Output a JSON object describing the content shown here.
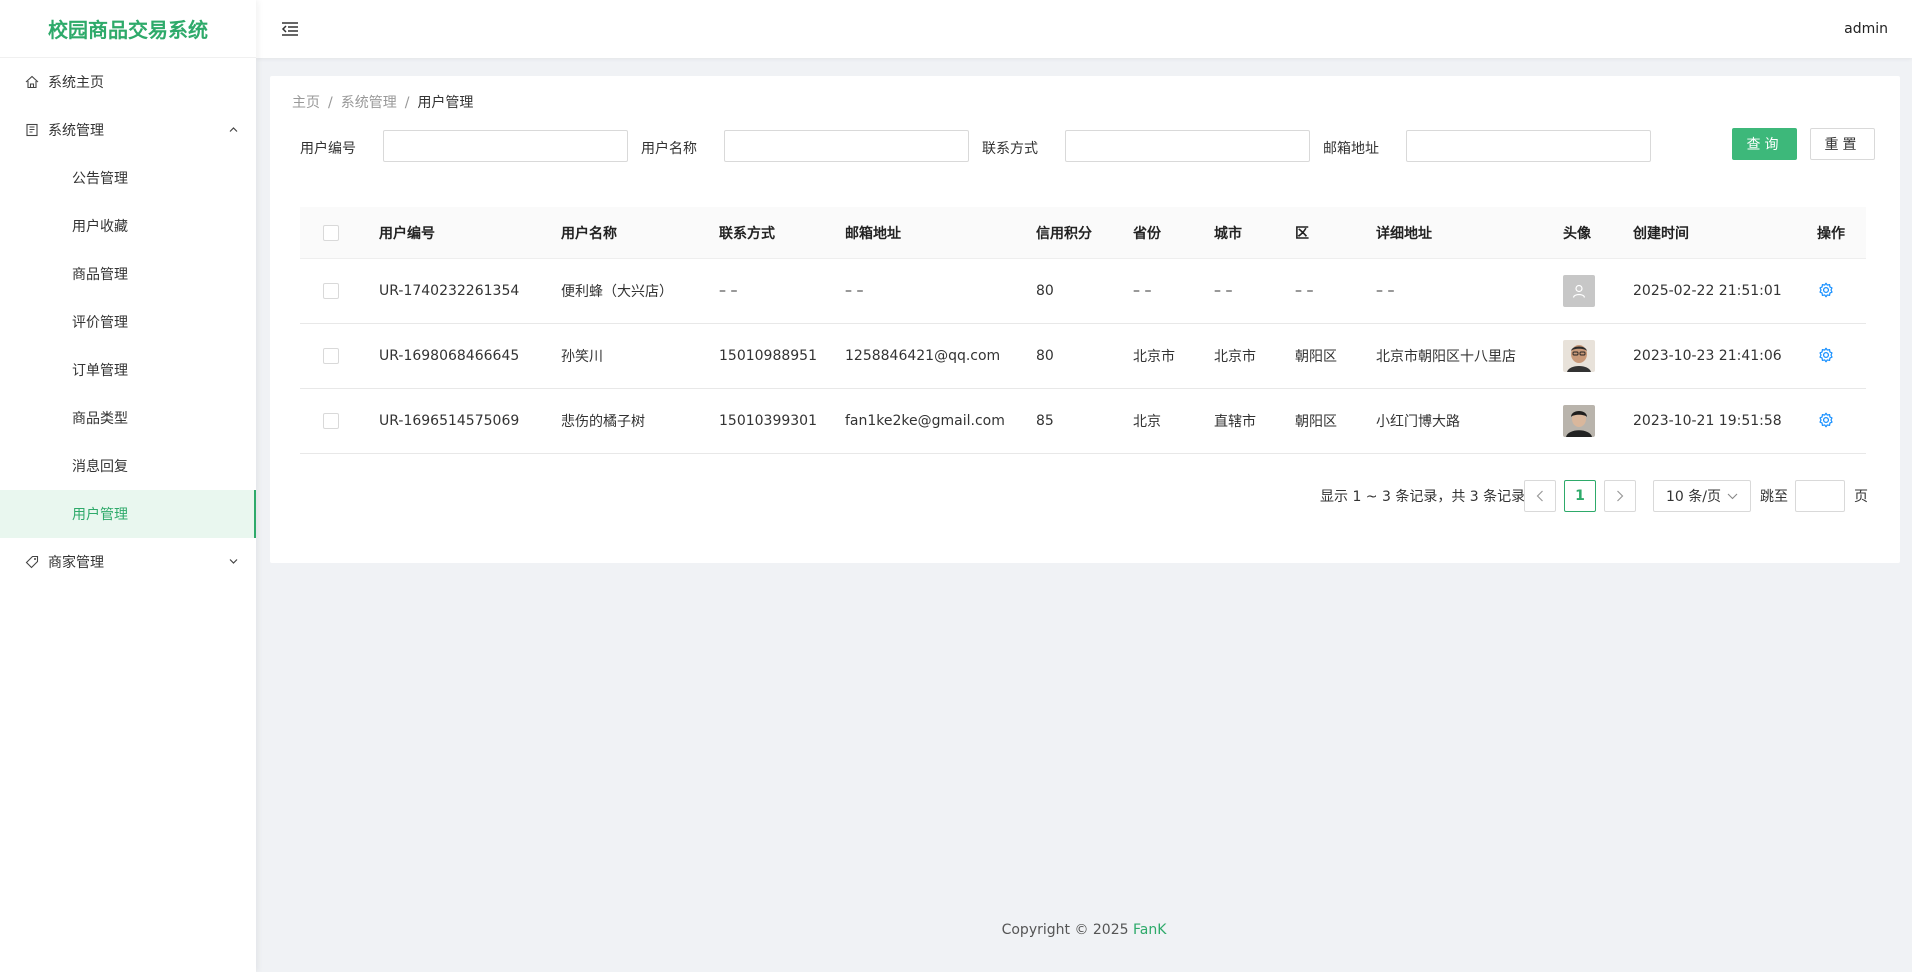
{
  "app": {
    "title": "校园商品交易系统"
  },
  "sidebar": {
    "items": [
      {
        "label": "系统主页",
        "icon": "home-icon"
      },
      {
        "label": "系统管理",
        "icon": "book-icon",
        "expanded": true,
        "children": [
          "公告管理",
          "用户收藏",
          "商品管理",
          "评价管理",
          "订单管理",
          "商品类型",
          "消息回复",
          "用户管理"
        ],
        "active_child": "用户管理"
      },
      {
        "label": "商家管理",
        "icon": "tag-icon",
        "expanded": false
      }
    ]
  },
  "header": {
    "user": "admin"
  },
  "breadcrumb": [
    "主页",
    "系统管理",
    "用户管理"
  ],
  "search": {
    "fields": [
      {
        "label": "用户编号",
        "value": ""
      },
      {
        "label": "用户名称",
        "value": ""
      },
      {
        "label": "联系方式",
        "value": ""
      },
      {
        "label": "邮箱地址",
        "value": ""
      }
    ],
    "query_label": "查询",
    "reset_label": "重置"
  },
  "table": {
    "columns": [
      "用户编号",
      "用户名称",
      "联系方式",
      "邮箱地址",
      "信用积分",
      "省份",
      "城市",
      "区",
      "详细地址",
      "头像",
      "创建时间",
      "操作"
    ],
    "rows": [
      {
        "id": "UR-1740232261354",
        "name": "便利蜂（大兴店）",
        "phone": "– –",
        "email": "– –",
        "credit": "80",
        "province": "– –",
        "city": "– –",
        "district": "– –",
        "address": "– –",
        "avatar": "default-avatar-icon",
        "created": "2025-02-22 21:51:01"
      },
      {
        "id": "UR-1698068466645",
        "name": "孙笑川",
        "phone": "15010988951",
        "email": "1258846421@qq.com",
        "credit": "80",
        "province": "北京市",
        "city": "北京市",
        "district": "朝阳区",
        "address": "北京市朝阳区十八里店",
        "avatar": "user-photo-icon",
        "created": "2023-10-23 21:41:06"
      },
      {
        "id": "UR-1696514575069",
        "name": "悲伤的橘子树",
        "phone": "15010399301",
        "email": "fan1ke2ke@gmail.com",
        "credit": "85",
        "province": "北京",
        "city": "直辖市",
        "district": "朝阳区",
        "address": "小红门博大路",
        "avatar": "user-photo-icon",
        "created": "2023-10-21 19:51:58"
      }
    ]
  },
  "pagination": {
    "summary": "显示 1 ~ 3 条记录，共 3 条记录",
    "current_page": "1",
    "page_size": "10 条/页",
    "jump_label": "跳至",
    "jump_suffix": "页"
  },
  "footer": {
    "copyright": "Copyright © 2025",
    "brand": "FanK"
  },
  "colors": {
    "accent": "#2eaa6a",
    "button": "#3db87a",
    "gear": "#1890ff"
  }
}
